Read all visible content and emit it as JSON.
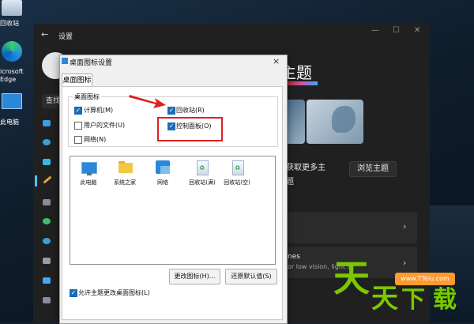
{
  "desktop": {
    "icons": [
      {
        "label": "回收站"
      },
      {
        "label": "icrosoft\nEdge"
      },
      {
        "label": "此电脑"
      }
    ]
  },
  "settings": {
    "title": "设置",
    "search_fragment": "查找",
    "heading": "主题",
    "get_more_themes": "获取更多主题",
    "browse_themes": "浏览主题",
    "contrast_fragment": "nes",
    "contrast_desc": "or low vision, light s"
  },
  "dialog": {
    "title": "桌面图标设置",
    "close": "×",
    "tab": "桌面图标",
    "group_label": "桌面图标",
    "checkboxes": {
      "computer": {
        "label": "计算机(M)",
        "checked": true
      },
      "recycle": {
        "label": "回收站(R)",
        "checked": true
      },
      "userfiles": {
        "label": "用户的文件(U)",
        "checked": false
      },
      "control": {
        "label": "控制面板(O)",
        "checked": true
      },
      "network": {
        "label": "网络(N)",
        "checked": false
      }
    },
    "icons": [
      {
        "label": "此电脑"
      },
      {
        "label": "系统之家"
      },
      {
        "label": "网络"
      },
      {
        "label": "回收站(满)"
      },
      {
        "label": "回收站(空)"
      }
    ],
    "change_icon_button": "更改图标(H)...",
    "restore_default_button": "还原默认值(S)",
    "allow_themes_label": "允许主题更改桌面图标(L)",
    "allow_themes_checked": true
  },
  "watermark": {
    "url": "www.TTeiu.com",
    "chars": [
      "天",
      "天",
      "下",
      "载"
    ]
  },
  "colors": {
    "accent": "#1a6bb8",
    "highlight": "#e02020",
    "watermark_green": "#7ac800",
    "watermark_orange": "#ff9a2e"
  }
}
